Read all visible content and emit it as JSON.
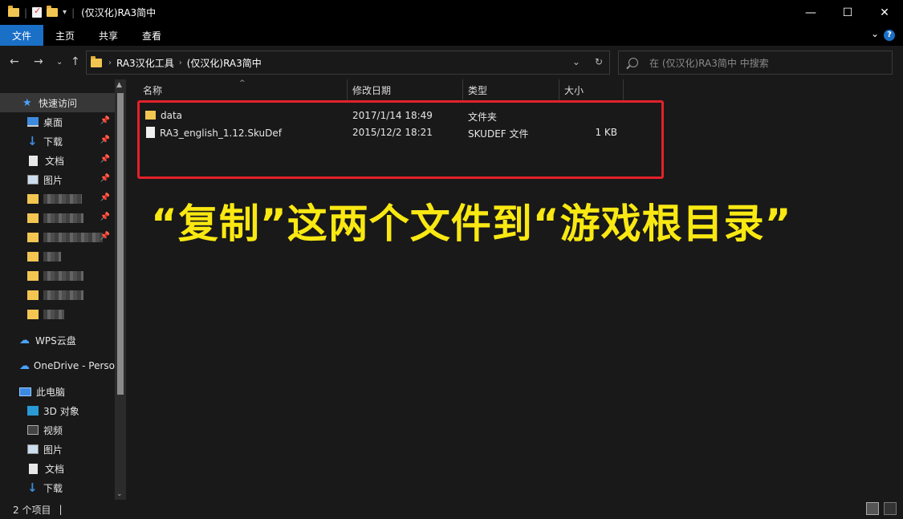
{
  "window": {
    "title": "(仅汉化)RA3简中",
    "minimize": "—",
    "maximize": "☐",
    "close": "✕"
  },
  "ribbon": {
    "tabs": [
      "文件",
      "主页",
      "共享",
      "查看"
    ],
    "help": "?"
  },
  "address": {
    "crumbs": [
      "RA3汉化工具",
      "(仅汉化)RA3简中"
    ],
    "search_placeholder": "在 (仅汉化)RA3简中 中搜索"
  },
  "sidebar": {
    "quick_access": "快速访问",
    "items": [
      "桌面",
      "下载",
      "文档",
      "图片"
    ],
    "wps": "WPS云盘",
    "onedrive": "OneDrive - Perso",
    "this_pc": "此电脑",
    "pc_items": [
      "3D 对象",
      "视频",
      "图片",
      "文档",
      "下载"
    ]
  },
  "columns": {
    "name": "名称",
    "date": "修改日期",
    "type": "类型",
    "size": "大小"
  },
  "files": [
    {
      "name": "data",
      "date": "2017/1/14 18:49",
      "type": "文件夹",
      "size": ""
    },
    {
      "name": "RA3_english_1.12.SkuDef",
      "date": "2015/12/2 18:21",
      "type": "SKUDEF 文件",
      "size": "1 KB"
    }
  ],
  "annotation": "“复制”这两个文件到“游戏根目录”",
  "status": {
    "count": "2 个项目",
    "sep": "|"
  },
  "colors": {
    "accent": "#1a6fc7",
    "highlight_box": "#e3212b",
    "caption": "#f9e812"
  }
}
